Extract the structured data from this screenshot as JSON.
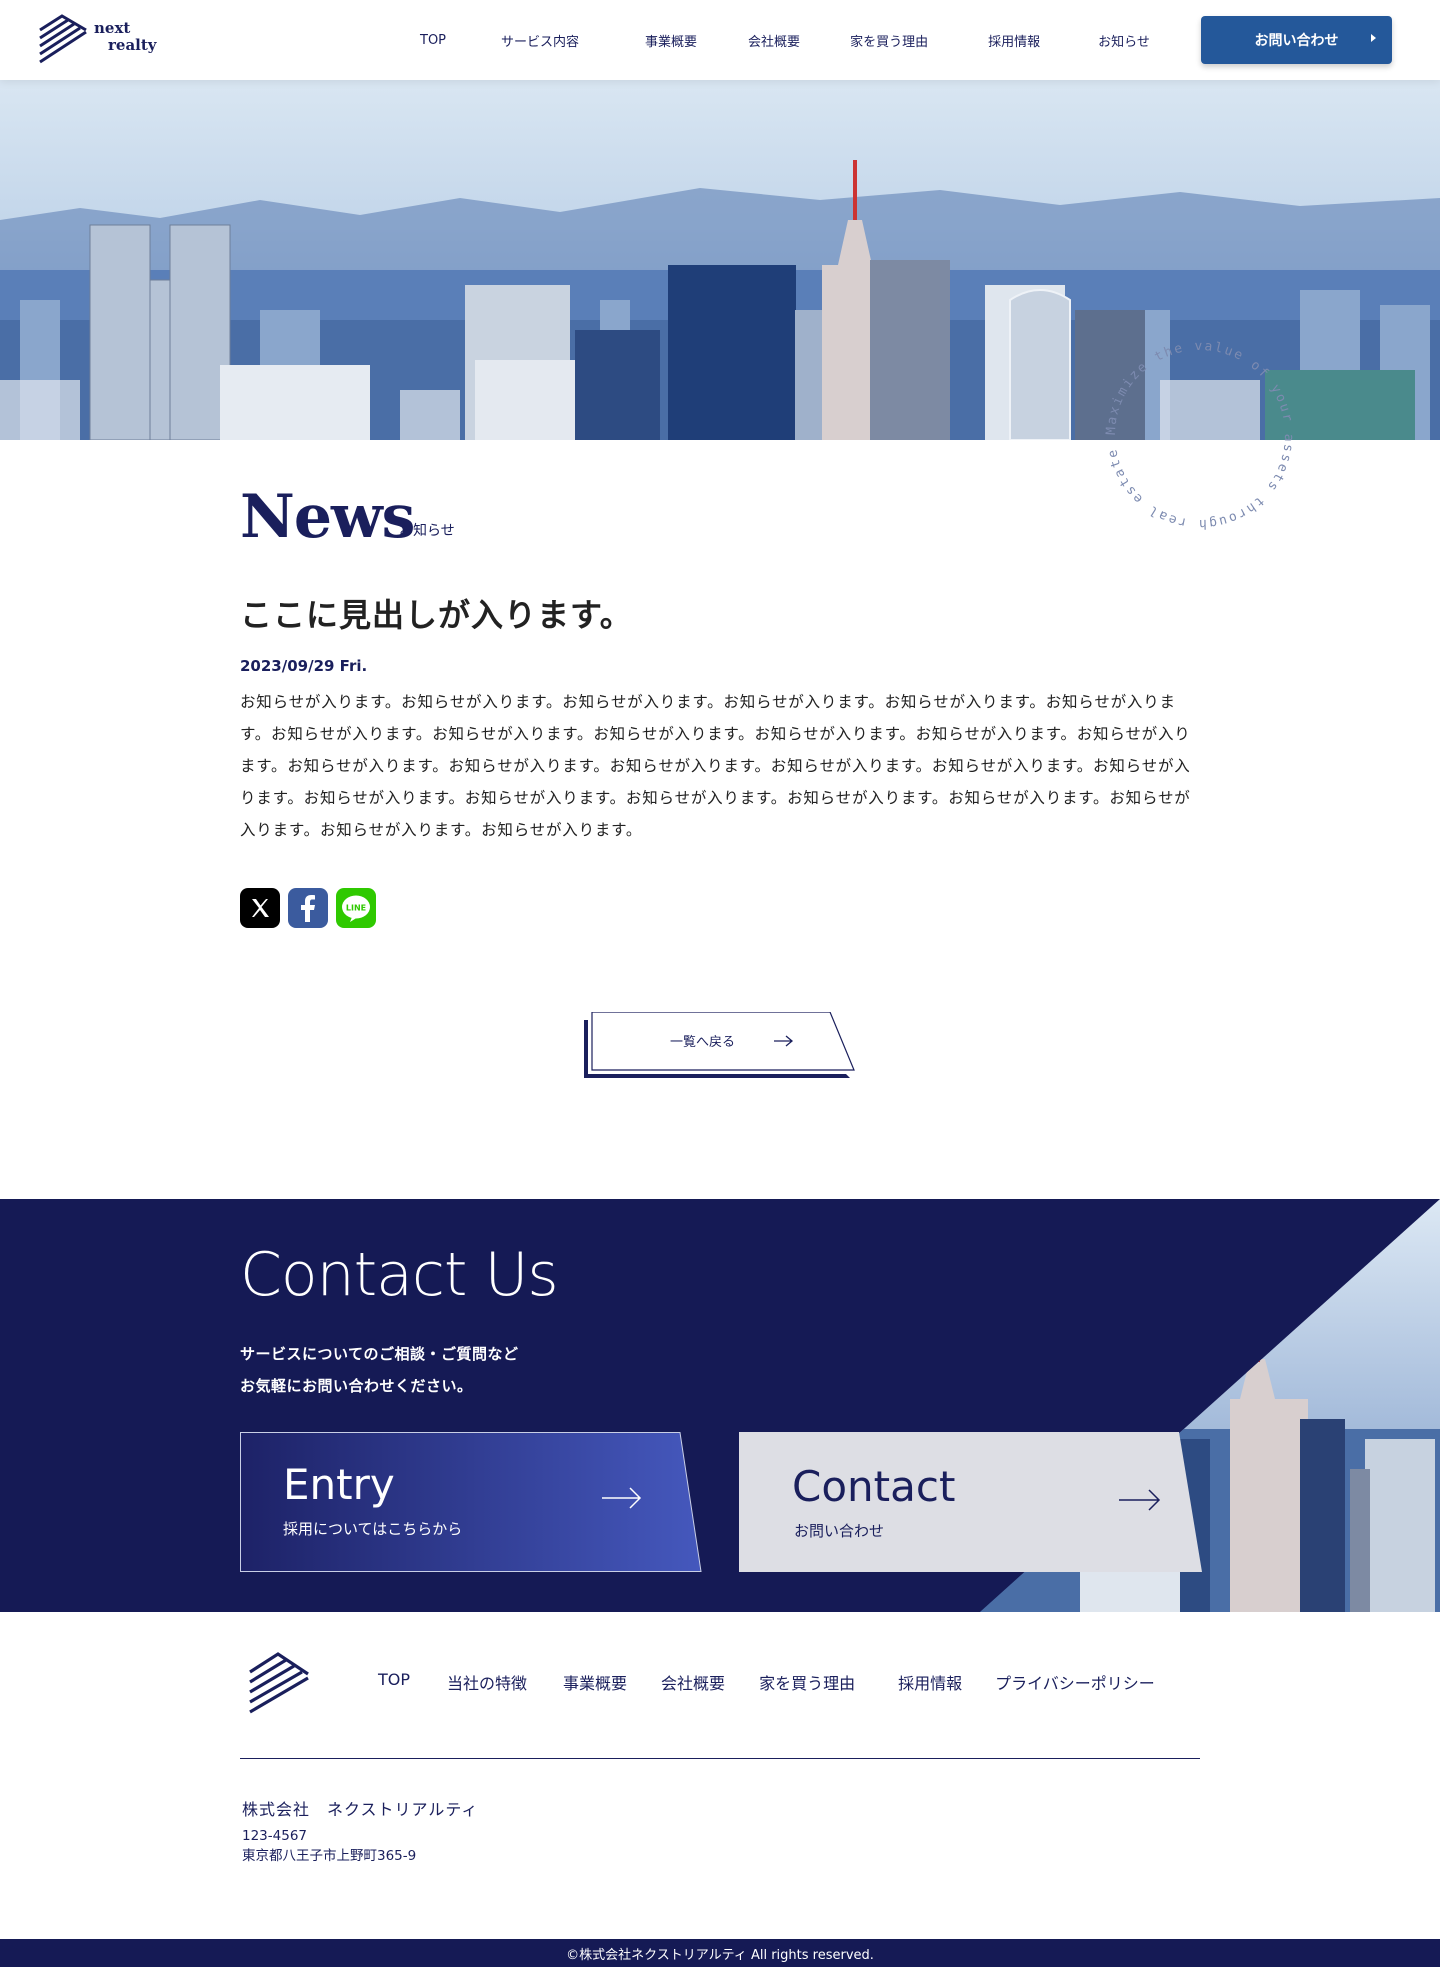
{
  "header": {
    "logo_line1": "next",
    "logo_line2": "realty",
    "nav": [
      "TOP",
      "サービス内容",
      "事業概要",
      "会社概要",
      "家を買う理由",
      "採用情報",
      "お知らせ"
    ],
    "cta_label": "お問い合わせ"
  },
  "hero": {
    "circle_text": "Maximize the value of your assets through real estate"
  },
  "news": {
    "title": "News",
    "subtitle": "お知らせ",
    "headline": "ここに見出しが入ります。",
    "date": "2023/09/29 Fri.",
    "body": "お知らせが入ります。お知らせが入ります。お知らせが入ります。お知らせが入ります。お知らせが入ります。お知らせが入ります。お知らせが入ります。お知らせが入ります。お知らせが入ります。お知らせが入ります。お知らせが入ります。お知らせが入ります。お知らせが入ります。お知らせが入ります。お知らせが入ります。お知らせが入ります。お知らせが入ります。お知らせが入ります。お知らせが入ります。お知らせが入ります。お知らせが入ります。お知らせが入ります。お知らせが入ります。お知らせが入ります。お知らせが入ります。お知らせが入ります。",
    "share_icons": [
      "x-icon",
      "facebook-icon",
      "line-icon"
    ],
    "line_label": "LINE",
    "back_label": "一覧へ戻る"
  },
  "contact": {
    "title": "Contact Us",
    "desc_line1": "サービスについてのご相談・ご質問など",
    "desc_line2": "お気軽にお問い合わせください。",
    "entry_title": "Entry",
    "entry_sub": "採用についてはこちらから",
    "contact_title": "Contact",
    "contact_sub": "お問い合わせ"
  },
  "footer": {
    "nav": [
      "TOP",
      "当社の特徴",
      "事業概要",
      "会社概要",
      "家を買う理由",
      "採用情報",
      "プライバシーポリシー"
    ],
    "company": "株式会社　ネクストリアルティ",
    "zip": "123-4567",
    "address": "東京都八王子市上野町365-9",
    "copyright": "©株式会社ネクストリアルティ All rights reserved."
  },
  "colors": {
    "navy": "#151a55",
    "accent_blue": "#24589a",
    "text_navy": "#1a1f5c"
  }
}
